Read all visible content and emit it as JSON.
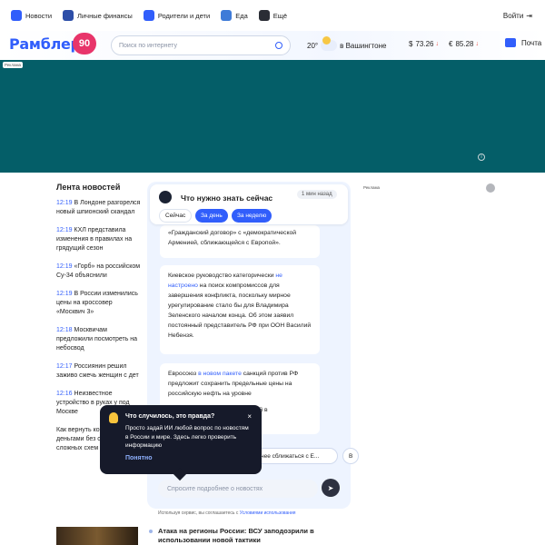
{
  "topnav": {
    "items": [
      {
        "label": "Новости",
        "color": "#315efb"
      },
      {
        "label": "Личные финансы",
        "color": "#2d4ea8"
      },
      {
        "label": "Родители и дети",
        "color": "#315efb"
      },
      {
        "label": "Еда",
        "color": "#3f7bd8"
      },
      {
        "label": "Ещё",
        "color": "#2a2d35"
      }
    ],
    "login": "Войти"
  },
  "header": {
    "logo": "Рамблер",
    "logo_badge": "90",
    "search_placeholder": "Поиск по интернету",
    "weather_temp": "20°",
    "weather_city": "в Вашингтоне",
    "rates": [
      {
        "symbol": "$",
        "value": "73.26"
      },
      {
        "symbol": "€",
        "value": "85.28"
      }
    ],
    "mail": "Почта"
  },
  "ad_label": "Реклама",
  "feed": {
    "title": "Лента новостей",
    "items": [
      {
        "time": "12:19",
        "text": "В Лондоне разгорелся новый шпионский скандал"
      },
      {
        "time": "12:19",
        "text": "КХЛ представила изменения в правилах на грядущий сезон"
      },
      {
        "time": "12:19",
        "text": "«Горб» на российском Су-34 объяснили"
      },
      {
        "time": "12:19",
        "text": "В России изменились цены на кроссовер «Москвич 3»"
      },
      {
        "time": "12:18",
        "text": "Москвичам предложили посмотреть на небосвод"
      },
      {
        "time": "12:17",
        "text": "Россиянин решил заживо сжечь женщин с дет"
      },
      {
        "time": "12:16",
        "text": "Неизвестное устройство в руках у под Москве"
      },
      {
        "time": "",
        "text": "Как вернуть контроль над деньгами без стресса и сложных схем"
      }
    ]
  },
  "widget": {
    "title": "Что нужно знать сейчас",
    "time_badge": "1 мин назад",
    "tabs": [
      "Сейчас",
      "За день",
      "За неделю"
    ],
    "cards": [
      {
        "pre": "«Гражданский договор» с «демократической Арменией, сближающейся с Европой».",
        "link": "",
        "post": ""
      },
      {
        "pre": "Киевское руководство категорически ",
        "link": "не настроено",
        "post": " на поиск компромиссов для завершения конфликта, поскольку мирное урегулирование стало бы для Владимира Зеленского началом конца. Об этом заявил постоянный представитель РФ при ООН Василий Небензя."
      },
      {
        "pre": "Евросоюз ",
        "link": "в новом пакете",
        "post": " санкций против РФ предложит сохранить предельные цены на российскую нефть на уровне"
      }
    ],
    "card3_tail": "ений в",
    "chips": [
      "нее сближаться с Е...",
      "В"
    ],
    "ask_placeholder": "Спросите подробнее о новостях",
    "disclaimer_pre": "Используя сервис, вы соглашаетесь с ",
    "disclaimer_link": "Условиями использования"
  },
  "tooltip": {
    "title": "Что случилось, это правда?",
    "text": "Просто задай ИИ любой вопрос по новостям в России и мире. Здесь легко проверить информацию",
    "more": "Понятно",
    "close": "×"
  },
  "bottom": {
    "headline": "Атака на регионы России: ВСУ заподозрили в использовании новой тактики"
  },
  "colors": {
    "accent": "#315efb",
    "banner": "#045e68",
    "tooltip_bg": "#161a2a"
  }
}
